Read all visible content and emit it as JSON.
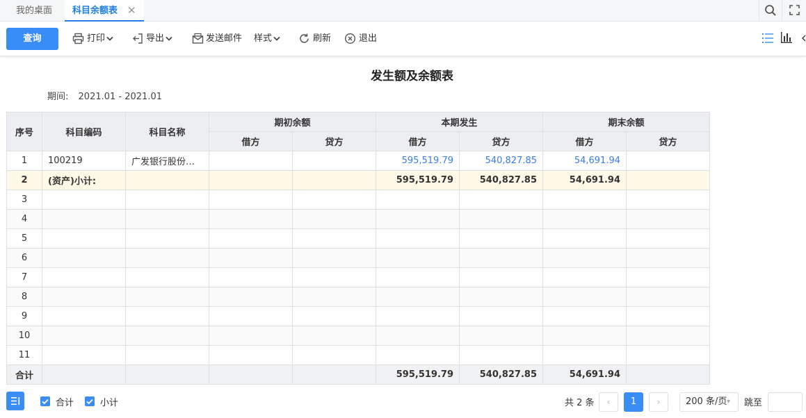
{
  "tabs": {
    "home": "我的桌面",
    "active": "科目余额表",
    "close": "✕"
  },
  "toolbar": {
    "query": "查询",
    "print": "打印",
    "export": "导出",
    "send_mail": "发送邮件",
    "style": "样式",
    "refresh": "刷新",
    "exit": "退出"
  },
  "report": {
    "title": "发生额及余额表",
    "period_label": "期间:",
    "period_value": "2021.01 - 2021.01"
  },
  "table": {
    "headers": {
      "index": "序号",
      "code": "科目编码",
      "name": "科目名称",
      "opening": "期初余额",
      "current": "本期发生",
      "closing": "期末余额",
      "debit": "借方",
      "credit": "贷方"
    },
    "rows": [
      {
        "index": "1",
        "code": "100219",
        "name": "广发银行股份…",
        "open_debit": "",
        "open_credit": "",
        "cur_debit": "595,519.79",
        "cur_credit": "540,827.85",
        "close_debit": "54,691.94",
        "close_credit": ""
      },
      {
        "index": "2",
        "code": "(资产)小计:",
        "name": "",
        "open_debit": "",
        "open_credit": "",
        "cur_debit": "595,519.79",
        "cur_credit": "540,827.85",
        "close_debit": "54,691.94",
        "close_credit": ""
      },
      {
        "index": "3"
      },
      {
        "index": "4"
      },
      {
        "index": "5"
      },
      {
        "index": "6"
      },
      {
        "index": "7"
      },
      {
        "index": "8"
      },
      {
        "index": "9"
      },
      {
        "index": "10"
      },
      {
        "index": "11"
      }
    ],
    "total": {
      "label": "合计",
      "cur_debit": "595,519.79",
      "cur_credit": "540,827.85",
      "close_debit": "54,691.94"
    }
  },
  "footer": {
    "check_total": "合计",
    "check_subtotal": "小计",
    "total_count": "共 2 条",
    "prev": "‹",
    "current_page": "1",
    "next": "›",
    "page_size": "200 条/页",
    "jump_label": "跳至"
  },
  "colors": {
    "accent": "#3a8df5",
    "link": "#3a7ee8",
    "subtotal_bg": "#fff9e8"
  }
}
